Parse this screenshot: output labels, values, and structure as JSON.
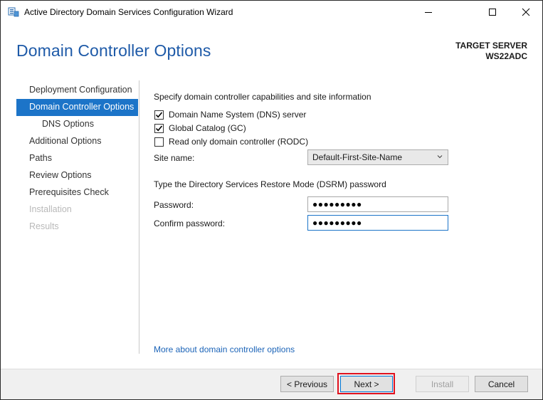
{
  "window": {
    "title": "Active Directory Domain Services Configuration Wizard"
  },
  "header": {
    "page_title": "Domain Controller Options",
    "target_label": "TARGET SERVER",
    "target_name": "WS22ADC"
  },
  "nav": {
    "items": [
      {
        "label": "Deployment Configuration",
        "state": "normal"
      },
      {
        "label": "Domain Controller Options",
        "state": "active"
      },
      {
        "label": "DNS Options",
        "state": "sub"
      },
      {
        "label": "Additional Options",
        "state": "normal"
      },
      {
        "label": "Paths",
        "state": "normal"
      },
      {
        "label": "Review Options",
        "state": "normal"
      },
      {
        "label": "Prerequisites Check",
        "state": "normal"
      },
      {
        "label": "Installation",
        "state": "disabled"
      },
      {
        "label": "Results",
        "state": "disabled"
      }
    ]
  },
  "main": {
    "capabilities_heading": "Specify domain controller capabilities and site information",
    "checkboxes": [
      {
        "label": "Domain Name System (DNS) server",
        "checked": true
      },
      {
        "label": "Global Catalog (GC)",
        "checked": true
      },
      {
        "label": "Read only domain controller (RODC)",
        "checked": false
      }
    ],
    "site_name_label": "Site name:",
    "site_name_value": "Default-First-Site-Name",
    "dsrm_heading": "Type the Directory Services Restore Mode (DSRM) password",
    "password_label": "Password:",
    "password_value": "●●●●●●●●●",
    "confirm_label": "Confirm password:",
    "confirm_value": "●●●●●●●●●",
    "more_link": "More about domain controller options"
  },
  "footer": {
    "previous": "< Previous",
    "next": "Next >",
    "install": "Install",
    "cancel": "Cancel"
  },
  "colors": {
    "accent": "#1c74c8",
    "title_blue": "#1e5aa8",
    "highlight": "#e0121e"
  }
}
